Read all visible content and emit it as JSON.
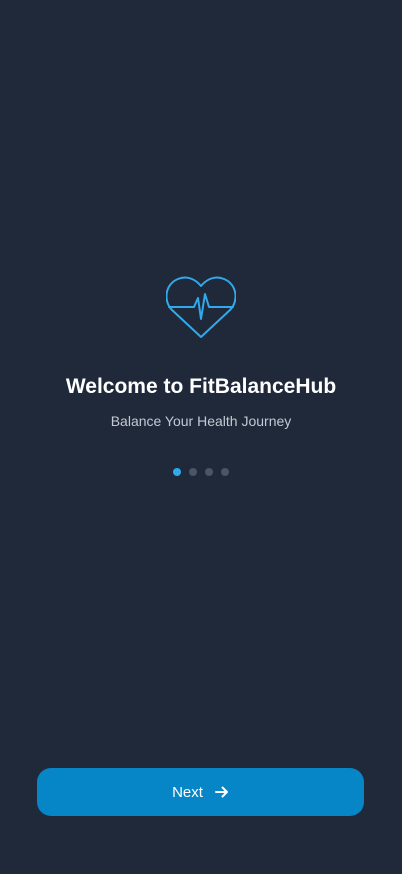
{
  "onboarding": {
    "title": "Welcome to FitBalanceHub",
    "subtitle": "Balance Your Health Journey",
    "logo_icon": "heart-pulse-icon",
    "page_indicator": {
      "current": 1,
      "total": 4
    },
    "next_label": "Next",
    "next_icon": "arrow-right-icon"
  },
  "colors": {
    "background": "#1f293a",
    "accent": "#31a9ea",
    "button": "#0685c7",
    "subtitle": "#c3c9d3",
    "dot_inactive": "#4a5566"
  }
}
